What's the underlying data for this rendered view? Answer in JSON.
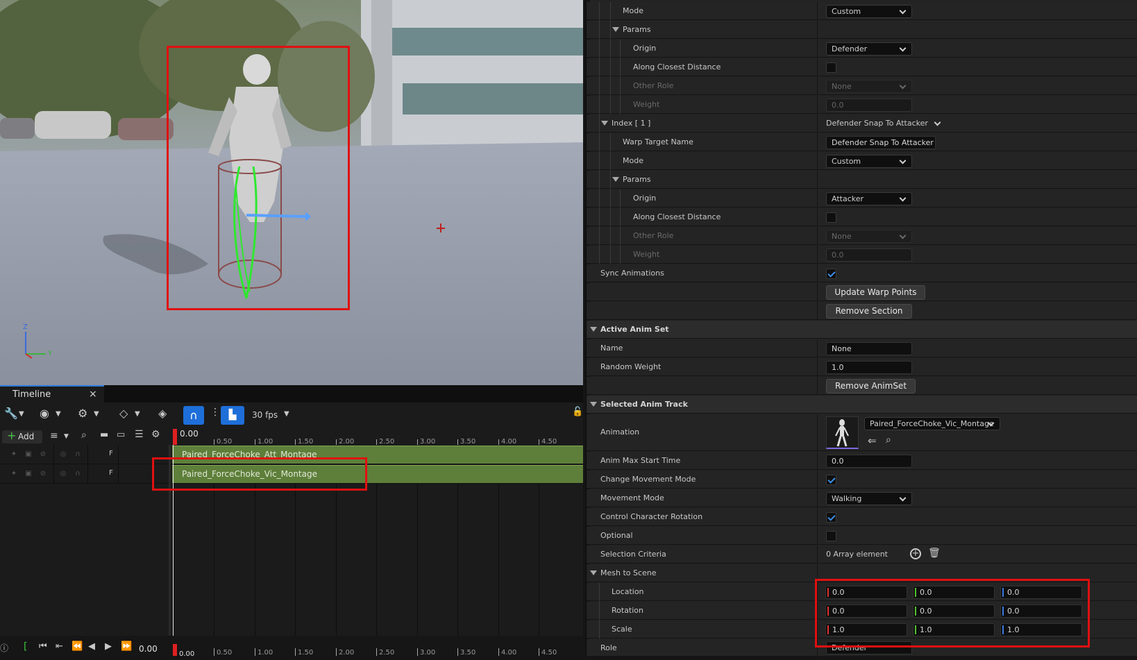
{
  "viewport": {
    "axis_z": "Z",
    "axis_y": "Y"
  },
  "timeline": {
    "tab_label": "Timeline",
    "close_glyph": "×",
    "fps_label": "30 fps",
    "add_label": "Add",
    "current_time": "0.00",
    "ruler_ticks": [
      "0.50",
      "1.00",
      "1.50",
      "2.00",
      "2.50",
      "3.00",
      "3.50",
      "4.00",
      "4.50"
    ],
    "bottom_time": "0.00",
    "bottom_time_marker": "0.00",
    "tracks": [
      {
        "letter": "F",
        "clip": "Paired_ForceChoke_Att_Montage"
      },
      {
        "letter": "F",
        "clip": "Paired_ForceChoke_Vic_Montage"
      }
    ]
  },
  "details": {
    "mode_label": "Mode",
    "mode_value": "Custom",
    "params_label": "Params",
    "origin_label": "Origin",
    "origin_value": "Defender",
    "along_label": "Along Closest Distance",
    "other_role_label": "Other Role",
    "other_role_value": "None",
    "weight_label": "Weight",
    "weight_value": "0.0",
    "index_label": "Index [ 1 ]",
    "index_value": "Defender Snap To Attacker",
    "warp_label": "Warp Target Name",
    "warp_value": "Defender Snap To Attacker",
    "mode2_label": "Mode",
    "mode2_value": "Custom",
    "params2_label": "Params",
    "origin2_label": "Origin",
    "origin2_value": "Attacker",
    "along2_label": "Along Closest Distance",
    "other_role2_label": "Other Role",
    "other_role2_value": "None",
    "weight2_label": "Weight",
    "weight2_value": "0.0",
    "sync_label": "Sync Animations",
    "update_btn": "Update Warp Points",
    "remove_section_btn": "Remove Section",
    "active_anim_set": "Active Anim Set",
    "name_label": "Name",
    "name_value": "None",
    "random_weight_label": "Random Weight",
    "random_weight_value": "1.0",
    "remove_animset_btn": "Remove AnimSet",
    "selected_track": "Selected Anim Track",
    "animation_label": "Animation",
    "animation_value": "Paired_ForceChoke_Vic_Montage",
    "anim_max_label": "Anim Max Start Time",
    "anim_max_value": "0.0",
    "change_move_label": "Change Movement Mode",
    "movement_mode_label": "Movement Mode",
    "movement_mode_value": "Walking",
    "control_rot_label": "Control Character Rotation",
    "optional_label": "Optional",
    "selection_label": "Selection Criteria",
    "selection_value": "0 Array element",
    "mesh_label": "Mesh to Scene",
    "location_label": "Location",
    "location": [
      "0.0",
      "0.0",
      "0.0"
    ],
    "rotation_label": "Rotation",
    "rotation": [
      "0.0",
      "0.0",
      "0.0"
    ],
    "scale_label": "Scale",
    "scale": [
      "1.0",
      "1.0",
      "1.0"
    ],
    "role_label": "Role",
    "role_value": "Defender"
  }
}
